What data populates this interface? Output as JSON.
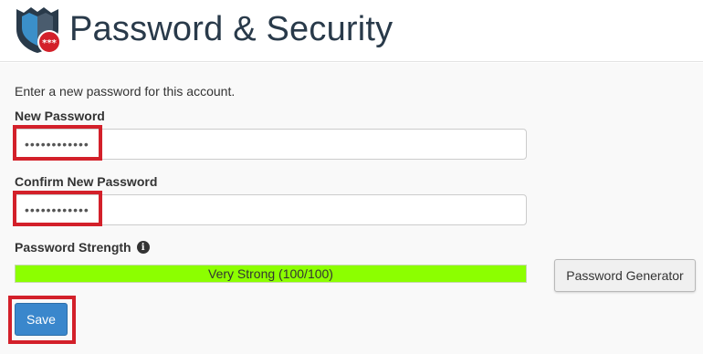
{
  "header": {
    "title": "Password & Security",
    "logo_badge": "***",
    "logo_icon": "shield-icon"
  },
  "form": {
    "intro": "Enter a new password for this account.",
    "new_password": {
      "label": "New Password",
      "value": "••••••••••••"
    },
    "confirm_password": {
      "label": "Confirm New Password",
      "value": "••••••••••••"
    },
    "strength": {
      "label": "Password Strength",
      "info_icon": "info-icon",
      "text": "Very Strong (100/100)",
      "score": 100,
      "bar_color": "#8cff00"
    },
    "generator_label": "Password Generator",
    "save_label": "Save"
  },
  "colors": {
    "highlight": "#d3202a",
    "primary_button": "#3a87cc",
    "title": "#293a4a"
  }
}
